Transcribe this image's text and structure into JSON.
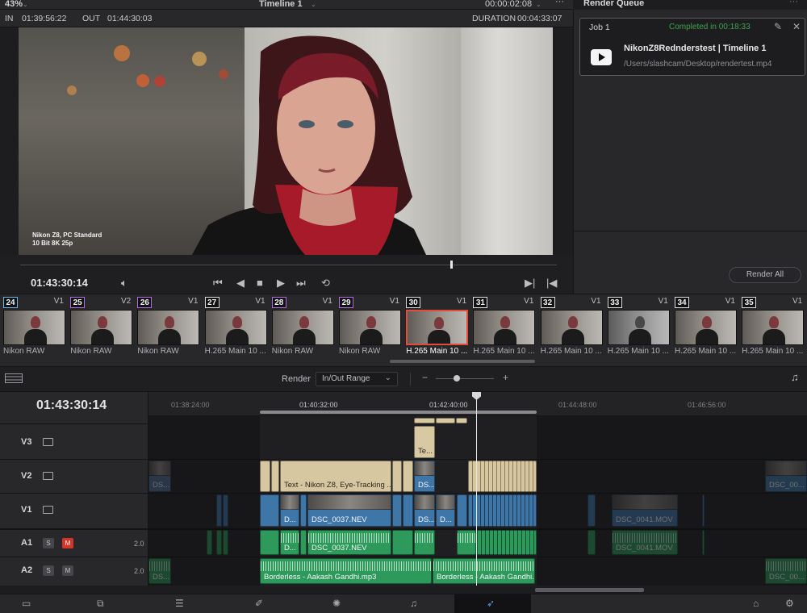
{
  "viewer_header": {
    "zoom": "43%",
    "timeline_name": "Timeline 1",
    "timecode": "00:00:02:08"
  },
  "inout": {
    "in_label": "IN",
    "in_tc": "01:39:56:22",
    "out_label": "OUT",
    "out_tc": "01:44:30:03",
    "duration_label": "DURATION",
    "duration_tc": "00:04:33:07"
  },
  "overlay": {
    "line1": "Nikon Z8, PC Standard",
    "line2": "10 Bit 8K 25p"
  },
  "transport": {
    "timecode": "01:43:30:14"
  },
  "render_queue": {
    "title": "Render Queue",
    "job": {
      "label": "Job 1",
      "status": "Completed in 00:18:33",
      "name": "NikonZ8Rednderstest | Timeline 1",
      "path": "/Users/slashcam/Desktop/rendertest.mp4"
    },
    "render_all": "Render All"
  },
  "clips": [
    {
      "num": "24",
      "track": "V1",
      "label": "Nikon RAW"
    },
    {
      "num": "25",
      "track": "V2",
      "label": "Nikon RAW"
    },
    {
      "num": "26",
      "track": "V1",
      "label": "Nikon RAW"
    },
    {
      "num": "27",
      "track": "V1",
      "label": "H.265 Main 10 ..."
    },
    {
      "num": "28",
      "track": "V1",
      "label": "Nikon RAW"
    },
    {
      "num": "29",
      "track": "V1",
      "label": "Nikon RAW"
    },
    {
      "num": "30",
      "track": "V1",
      "label": "H.265 Main 10 ..."
    },
    {
      "num": "31",
      "track": "V1",
      "label": "H.265 Main 10 ..."
    },
    {
      "num": "32",
      "track": "V1",
      "label": "H.265 Main 10 ..."
    },
    {
      "num": "33",
      "track": "V1",
      "label": "H.265 Main 10 ..."
    },
    {
      "num": "34",
      "track": "V1",
      "label": "H.265 Main 10 ..."
    },
    {
      "num": "35",
      "track": "V1",
      "label": "H.265 Main 10 ..."
    }
  ],
  "toolbar": {
    "render_label": "Render",
    "render_range": "In/Out Range"
  },
  "timeline": {
    "timecode": "01:43:30:14",
    "ruler": [
      "01:38:24:00",
      "01:40:32:00",
      "01:42:40:00",
      "01:44:48:00",
      "01:46:56:00"
    ],
    "tracks": {
      "v3": "V3",
      "v2": "V2",
      "v1": "V1",
      "a1": "A1",
      "a2": "A2",
      "solo": "S",
      "mute": "M",
      "a1_ch": "2.0",
      "a2_ch": "2.0"
    },
    "clip_names": {
      "v3_te": "Te...",
      "v2_ds_left": "DS...",
      "v2_text": "Text - Nikon Z8, Eye-Tracking ...",
      "v2_ds_mid": "DS...",
      "v2_ds_right": "DSC_00...",
      "v1_d": "D...",
      "v1_main": "DSC_0037.NEV",
      "v1_ds": "DS...",
      "v1_d2": "D...",
      "v1_right": "DSC_0041.MOV",
      "a1_d": "D...",
      "a1_main": "DSC_0037.NEV",
      "a1_right": "DSC_0041.MOV",
      "a2_ds_left": "DS...",
      "a2_bl1": "Borderless - Aakash Gandhi.mp3",
      "a2_bl2": "Borderless - Aakash Gandhi...",
      "a2_right": "DSC_00..."
    }
  }
}
